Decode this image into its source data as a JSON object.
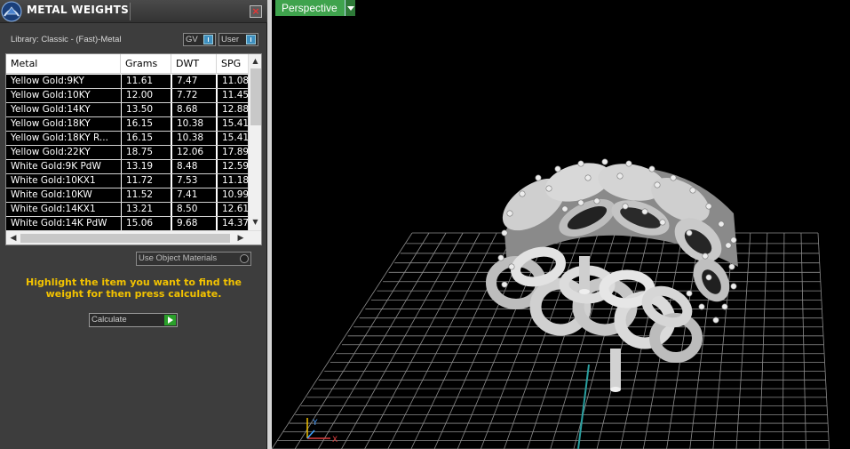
{
  "panel": {
    "title": "METAL WEIGHTS",
    "close_label": "×",
    "library": "Library: Classic - (Fast)-Metal",
    "gv_label": "GV",
    "user_label": "User",
    "hint": "Highlight the item you want to find the weight for then press calculate.",
    "use_object_materials": "Use Object Materials",
    "calculate": "Calculate"
  },
  "table": {
    "columns": [
      "Metal",
      "Grams",
      "DWT",
      "SPG"
    ],
    "rows": [
      [
        "Yellow Gold:9KY",
        "11.61",
        "7.47",
        "11.08"
      ],
      [
        "Yellow Gold:10KY",
        "12.00",
        "7.72",
        "11.45"
      ],
      [
        "Yellow Gold:14KY",
        "13.50",
        "8.68",
        "12.88"
      ],
      [
        "Yellow Gold:18KY",
        "16.15",
        "10.38",
        "15.41"
      ],
      [
        "Yellow Gold:18KY R...",
        "16.15",
        "10.38",
        "15.41"
      ],
      [
        "Yellow Gold:22KY",
        "18.75",
        "12.06",
        "17.89"
      ],
      [
        "White Gold:9K PdW",
        "13.19",
        "8.48",
        "12.59"
      ],
      [
        "White Gold:10KX1",
        "11.72",
        "7.53",
        "11.18"
      ],
      [
        "White Gold:10KW",
        "11.52",
        "7.41",
        "10.99"
      ],
      [
        "White Gold:14KX1",
        "13.21",
        "8.50",
        "12.61"
      ],
      [
        "White Gold:14K PdW",
        "15.06",
        "9.68",
        "14.37"
      ]
    ]
  },
  "viewport": {
    "view_label": "Perspective",
    "axis_x": "X",
    "axis_y": "Y",
    "background": "#000000",
    "grid_color": "#8c8c8c"
  },
  "colors": {
    "hint": "#f2c200",
    "view_tab": "#3fa34d",
    "toggle_accent": "#3e8fbf",
    "calc_go": "#2aa02a"
  }
}
